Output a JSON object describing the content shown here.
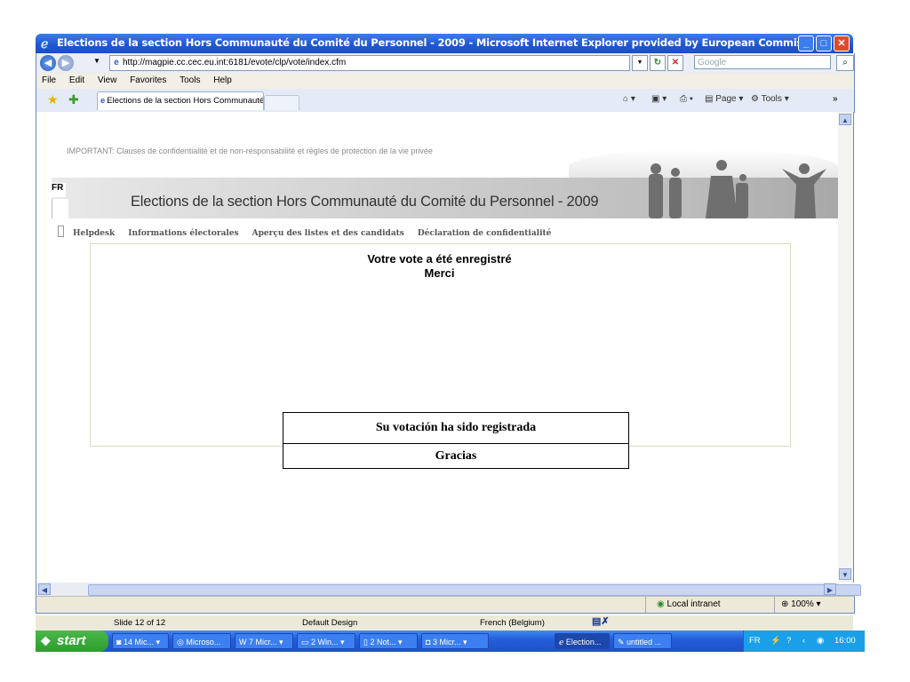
{
  "window": {
    "title": "Elections de la section Hors Communauté du Comité du Personnel - 2009 - Microsoft Internet Explorer provided by European Commis"
  },
  "address": {
    "url": "http://magpie.cc.cec.eu.int:6181/evote/clp/vote/index.cfm",
    "search_placeholder": "Google"
  },
  "menu": [
    "File",
    "Edit",
    "View",
    "Favorites",
    "Tools",
    "Help"
  ],
  "tab": {
    "label": "Elections de la section Hors Communauté du Comité d..."
  },
  "toolbar": {
    "page_label": "Page",
    "tools_label": "Tools"
  },
  "page": {
    "important": "IMPORTANT: Clauses de confidentialité et de non-responsabilité et règles de protection de la vie privée",
    "lang": "FR",
    "banner_title": "Elections de la section Hors Communauté du Comité du Personnel  - 2009",
    "nav": [
      "Helpdesk",
      "Informations électorales",
      "Aperçu des listes et des candidats",
      "Déclaration de confidentialité"
    ],
    "message_line1": "Votre vote a été enregistré",
    "message_line2": "Merci"
  },
  "overlay": {
    "line1": "Su votación ha sido registrada",
    "line2": "Gracias"
  },
  "status": {
    "zone": "Local intranet",
    "zoom": "100%"
  },
  "ppt_status": {
    "slide": "Slide 12 of 12",
    "design": "Default Design",
    "language": "French (Belgium)"
  },
  "taskbar": {
    "start_label": "start",
    "items": [
      "14 Mic...",
      "Microso...",
      "7 Micr...",
      "2 Win...",
      "2 Not...",
      "3 Micr...",
      "Election...",
      "untitled ..."
    ],
    "lang": "FR",
    "clock": "16:00"
  }
}
